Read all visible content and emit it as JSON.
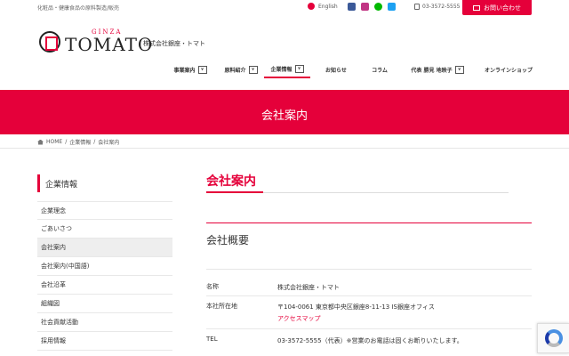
{
  "header": {
    "tagline": "化粧品・健康食品の原料製造/販売",
    "language": "English",
    "phone": "03-3572-5555",
    "contact_label": "お問い合わせ",
    "logo_ginza": "GINZA",
    "logo_tomato": "TOMATO",
    "company_name": "株式会社銀座・トマト",
    "socials": [
      {
        "name": "facebook",
        "color": "#3b5998"
      },
      {
        "name": "instagram",
        "color": "#c13584"
      },
      {
        "name": "line",
        "color": "#00b900"
      },
      {
        "name": "twitter",
        "color": "#1da1f2"
      }
    ]
  },
  "nav": {
    "items": [
      {
        "label": "事業案内",
        "dropdown": true,
        "active": false
      },
      {
        "label": "原料紹介",
        "dropdown": true,
        "active": false
      },
      {
        "label": "企業情報",
        "dropdown": true,
        "active": true
      },
      {
        "label": "お知らせ",
        "dropdown": false,
        "active": false
      },
      {
        "label": "コラム",
        "dropdown": false,
        "active": false
      },
      {
        "label": "代表 勝見 地映子",
        "dropdown": true,
        "active": false
      },
      {
        "label": "オンラインショップ",
        "dropdown": false,
        "active": false
      }
    ]
  },
  "hero": {
    "title": "会社案内"
  },
  "breadcrumb": {
    "home": "HOME",
    "separator": "/",
    "parent": "企業情報",
    "current": "会社案内"
  },
  "sidebar": {
    "title": "企業情報",
    "items": [
      {
        "label": "企業理念",
        "active": false
      },
      {
        "label": "ごあいさつ",
        "active": false
      },
      {
        "label": "会社案内",
        "active": true
      },
      {
        "label": "会社案内(中国語)",
        "active": false
      },
      {
        "label": "会社沿革",
        "active": false
      },
      {
        "label": "組織図",
        "active": false
      },
      {
        "label": "社会貢献活動",
        "active": false
      },
      {
        "label": "採用情報",
        "active": false
      }
    ]
  },
  "main": {
    "title": "会社案内",
    "section_title": "会社概要",
    "rows": [
      {
        "label": "名称",
        "value": "株式会社銀座・トマト",
        "link": ""
      },
      {
        "label": "本社所在地",
        "value": "〒104-0061 東京都中央区銀座8-11-13 IS銀座オフィス",
        "link": "アクセスマップ"
      },
      {
        "label": "TEL",
        "value": "03-3572-5555（代表）※営業のお電話は固くお断りいたします。",
        "link": ""
      }
    ]
  },
  "colors": {
    "brand_red": "#e5003a"
  }
}
